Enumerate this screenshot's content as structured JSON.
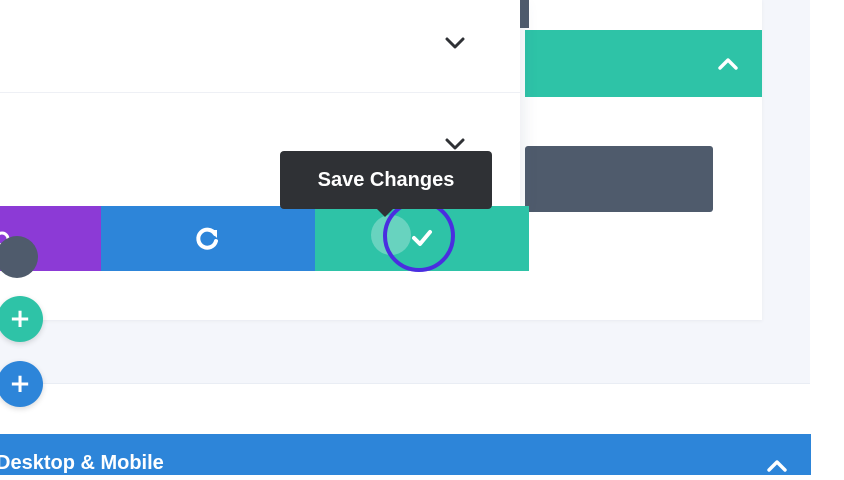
{
  "tooltip": {
    "text": "Save Changes"
  },
  "section": {
    "title": "Desktop & Mobile"
  },
  "icons": {
    "row_chevron": "chevron-down-icon",
    "panel_chevron": "chevron-up-icon",
    "redo": "redo-icon",
    "save": "check-icon",
    "add": "plus-icon"
  },
  "buttons": {
    "add_symbol": "+"
  },
  "colors": {
    "green": "#2ec3a7",
    "blue": "#2d85d9",
    "purple": "#8c3ad6",
    "dark": "#4f5b6c",
    "tooltip_bg": "#2f3135",
    "highlight": "#4a2ee0"
  }
}
